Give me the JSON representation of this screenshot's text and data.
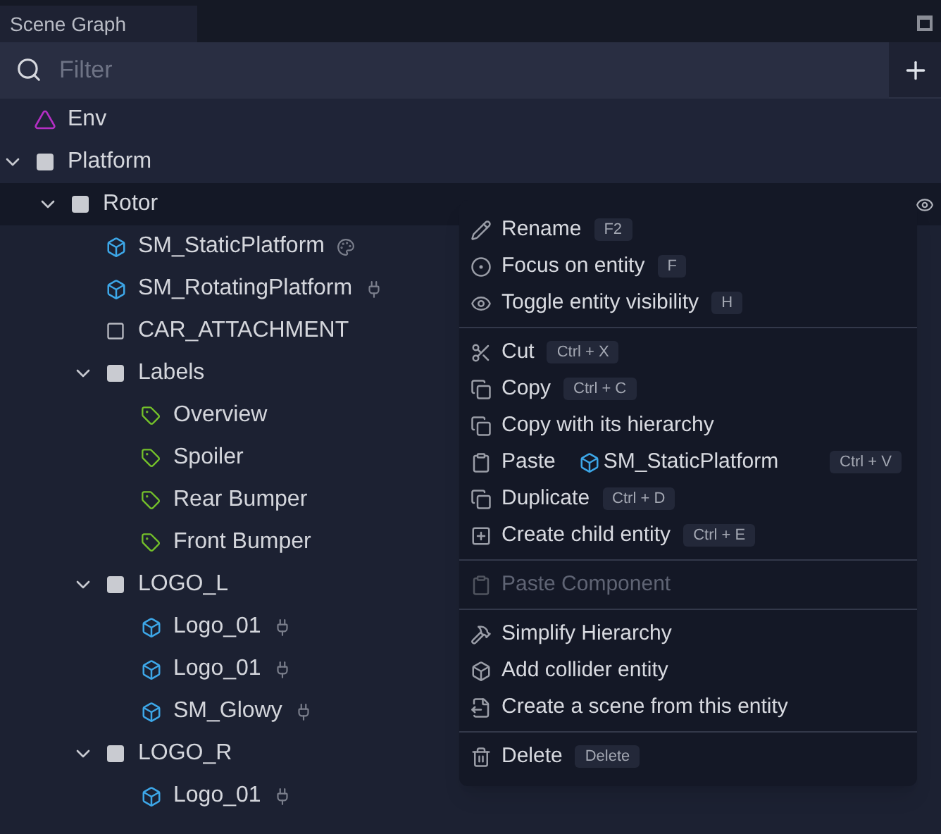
{
  "panel": {
    "title": "Scene Graph"
  },
  "filter": {
    "placeholder": "Filter"
  },
  "tree": [
    {
      "name": "Env",
      "kind": "env",
      "selected": false
    },
    {
      "name": "Platform",
      "kind": "group",
      "selected": false,
      "expanded": true,
      "children": [
        {
          "name": "Rotor",
          "kind": "group",
          "selected": true,
          "expanded": true,
          "visible": true,
          "children": [
            {
              "name": "SM_StaticPlatform",
              "kind": "mesh",
              "selected": false,
              "has_material": true
            },
            {
              "name": "SM_RotatingPlatform",
              "kind": "mesh",
              "selected": false,
              "has_script": true
            },
            {
              "name": "CAR_ATTACHMENT",
              "kind": "empty",
              "selected": false
            },
            {
              "name": "Labels",
              "kind": "group",
              "selected": false,
              "expanded": true,
              "children": [
                {
                  "name": "Overview",
                  "kind": "label",
                  "selected": false
                },
                {
                  "name": "Spoiler",
                  "kind": "label",
                  "selected": false
                },
                {
                  "name": "Rear Bumper",
                  "kind": "label",
                  "selected": false
                },
                {
                  "name": "Front Bumper",
                  "kind": "label",
                  "selected": false
                }
              ]
            },
            {
              "name": "LOGO_L",
              "kind": "group",
              "selected": false,
              "expanded": true,
              "children": [
                {
                  "name": "Logo_01",
                  "kind": "mesh",
                  "selected": false,
                  "has_script": true
                },
                {
                  "name": "Logo_01",
                  "kind": "mesh",
                  "selected": false,
                  "has_script": true
                },
                {
                  "name": "SM_Glowy",
                  "kind": "mesh",
                  "selected": false,
                  "has_script": true
                }
              ]
            },
            {
              "name": "LOGO_R",
              "kind": "group",
              "selected": false,
              "expanded": true,
              "children": [
                {
                  "name": "Logo_01",
                  "kind": "mesh",
                  "selected": false,
                  "has_script": true
                }
              ]
            }
          ]
        }
      ]
    }
  ],
  "context_menu": {
    "groups": [
      [
        {
          "label": "Rename",
          "shortcut": "F2",
          "disabled": false
        },
        {
          "label": "Focus on entity",
          "shortcut": "F",
          "disabled": false
        },
        {
          "label": "Toggle entity visibility",
          "shortcut": "H",
          "disabled": false
        }
      ],
      [
        {
          "label": "Cut",
          "shortcut": "Ctrl + X",
          "disabled": false
        },
        {
          "label": "Copy",
          "shortcut": "Ctrl + C",
          "disabled": false
        },
        {
          "label": "Copy with its hierarchy",
          "disabled": false
        },
        {
          "label": "Paste",
          "target": "SM_StaticPlatform",
          "shortcut": "Ctrl + V",
          "disabled": false
        },
        {
          "label": "Duplicate",
          "shortcut": "Ctrl + D",
          "disabled": false
        },
        {
          "label": "Create child entity",
          "shortcut": "Ctrl + E",
          "disabled": false
        }
      ],
      [
        {
          "label": "Paste Component",
          "disabled": true
        }
      ],
      [
        {
          "label": "Simplify Hierarchy",
          "disabled": false
        },
        {
          "label": "Add collider entity",
          "disabled": false
        },
        {
          "label": "Create a scene from this entity",
          "disabled": false
        }
      ],
      [
        {
          "label": "Delete",
          "shortcut": "Delete",
          "disabled": false
        }
      ]
    ]
  }
}
